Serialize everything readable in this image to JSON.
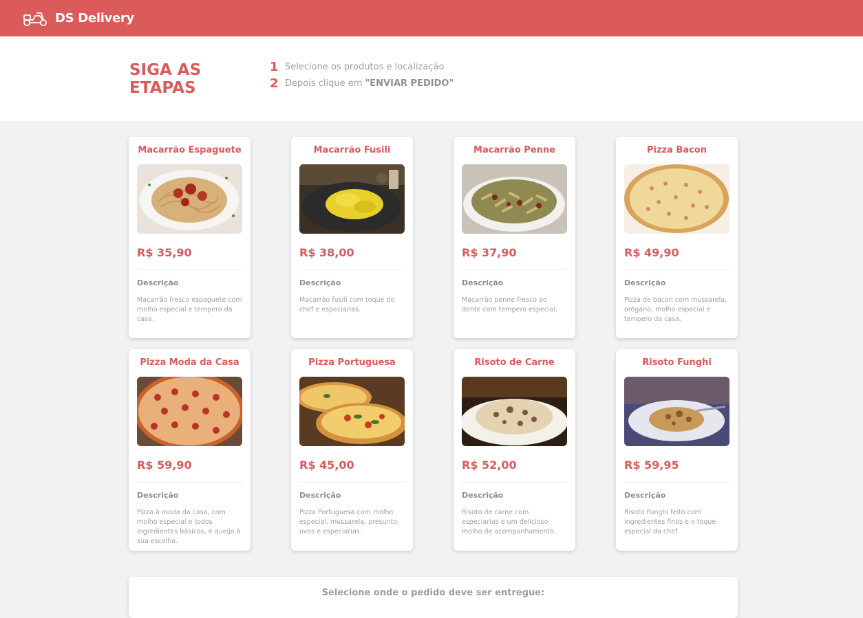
{
  "navbar": {
    "brand": "DS Delivery",
    "logo_icon": "scooter-icon",
    "background": "#db5a5a"
  },
  "steps": {
    "title": "SIGA AS ETAPAS",
    "items": [
      {
        "number": "1",
        "text": "Selecione os produtos e localização",
        "strong": ""
      },
      {
        "number": "2",
        "text": "Depois clique em ",
        "strong": "\"ENVIAR PEDIDO\""
      }
    ]
  },
  "products": [
    {
      "name": "Macarrão Espaguete",
      "image": "spaghetti-image",
      "price": "R$ 35,90",
      "description_label": "Descrição",
      "description": "Macarrão fresco espaguete com molho especial e tempero da casa."
    },
    {
      "name": "Macarrão Fusili",
      "image": "fusili-image",
      "price": "R$ 38,00",
      "description_label": "Descrição",
      "description": "Macarrão fusili com toque do chef e especiarias."
    },
    {
      "name": "Macarrão Penne",
      "image": "penne-image",
      "price": "R$ 37,90",
      "description_label": "Descrição",
      "description": "Macarrão penne fresco ao dente com tempero especial."
    },
    {
      "name": "Pizza Bacon",
      "image": "pizza-bacon-image",
      "price": "R$ 49,90",
      "description_label": "Descrição",
      "description": "Pizza de bacon com mussarela, orégano, molho especial e tempero da casa."
    },
    {
      "name": "Pizza Moda da Casa",
      "image": "pizza-moda-image",
      "price": "R$ 59,90",
      "description_label": "Descrição",
      "description": "Pizza à moda da casa, com molho especial e todos ingredientes básicos, e queijo à sua escolha."
    },
    {
      "name": "Pizza Portuguesa",
      "image": "pizza-portuguesa-image",
      "price": "R$ 45,00",
      "description_label": "Descrição",
      "description": "Pizza Portuguesa com molho especial, mussarela, presunto, ovos e especiarias."
    },
    {
      "name": "Risoto de Carne",
      "image": "risoto-carne-image",
      "price": "R$ 52,00",
      "description_label": "Descrição",
      "description": "Risoto de carne com especiarias e um delicioso molho de acompanhamento."
    },
    {
      "name": "Risoto Funghi",
      "image": "risoto-funghi-image",
      "price": "R$ 59,95",
      "description_label": "Descrição",
      "description": "Risoto Funghi feito com ingredientes finos e o toque especial do chef."
    }
  ],
  "location": {
    "title": "Selecione onde o pedido deve ser entregue:"
  },
  "colors": {
    "accent": "#db5a5a",
    "background": "#f2f2f2",
    "text_muted": "#9e9e9e"
  }
}
